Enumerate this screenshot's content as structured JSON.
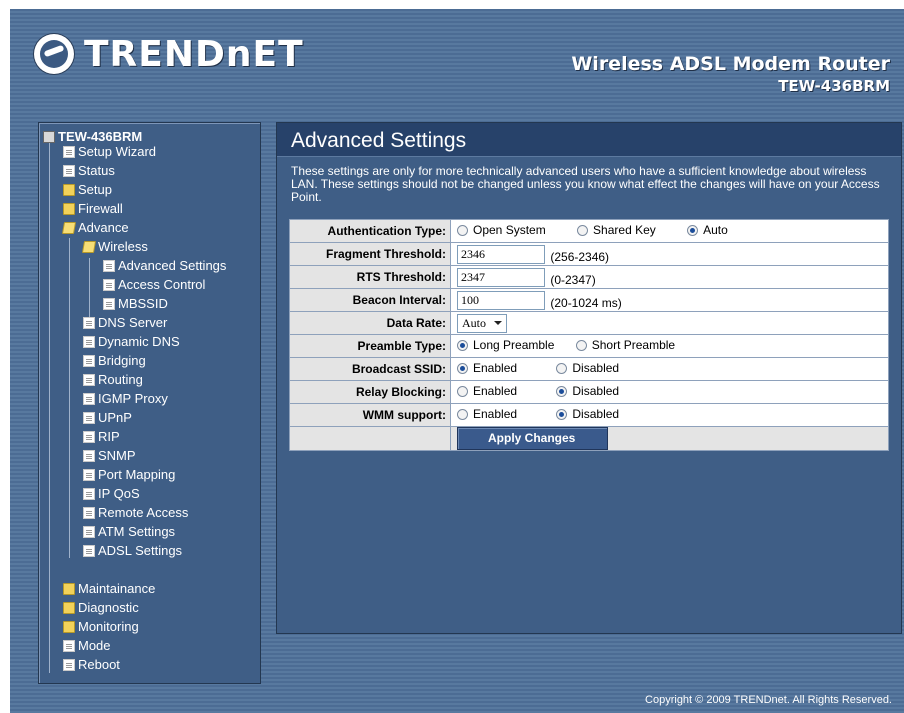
{
  "header": {
    "brand": "TRENDnET",
    "product_title": "Wireless ADSL Modem Router",
    "model": "TEW-436BRM"
  },
  "sidebar": {
    "root": "TEW-436BRM",
    "items": {
      "setup_wizard": "Setup Wizard",
      "status": "Status",
      "setup": "Setup",
      "firewall": "Firewall",
      "advance": "Advance",
      "wireless": "Wireless",
      "advanced_settings": "Advanced Settings",
      "access_control": "Access Control",
      "mbssid": "MBSSID",
      "dns_server": "DNS Server",
      "dynamic_dns": "Dynamic DNS",
      "bridging": "Bridging",
      "routing": "Routing",
      "igmp_proxy": "IGMP Proxy",
      "upnp": "UPnP",
      "rip": "RIP",
      "snmp": "SNMP",
      "port_mapping": "Port Mapping",
      "ip_qos": "IP QoS",
      "remote_access": "Remote Access",
      "atm_settings": "ATM Settings",
      "adsl_settings": "ADSL Settings",
      "maintainance": "Maintainance",
      "diagnostic": "Diagnostic",
      "monitoring": "Monitoring",
      "mode": "Mode",
      "reboot": "Reboot"
    }
  },
  "main": {
    "title": "Advanced Settings",
    "description": "These settings are only for more technically advanced users who have a sufficient knowledge about wireless LAN. These settings should not be changed unless you know what effect the changes will have on your Access Point.",
    "authentication": {
      "label": "Authentication Type:",
      "options": [
        "Open System",
        "Shared Key",
        "Auto"
      ],
      "selected": "Auto"
    },
    "fragment": {
      "label": "Fragment Threshold:",
      "value": "2346",
      "hint": "(256-2346)"
    },
    "rts": {
      "label": "RTS Threshold:",
      "value": "2347",
      "hint": "(0-2347)"
    },
    "beacon": {
      "label": "Beacon Interval:",
      "value": "100",
      "hint": "(20-1024 ms)"
    },
    "data_rate": {
      "label": "Data Rate:",
      "value": "Auto"
    },
    "preamble": {
      "label": "Preamble Type:",
      "options": [
        "Long Preamble",
        "Short Preamble"
      ],
      "selected": "Long Preamble"
    },
    "broadcast_ssid": {
      "label": "Broadcast SSID:",
      "options": [
        "Enabled",
        "Disabled"
      ],
      "selected": "Enabled"
    },
    "relay_blocking": {
      "label": "Relay Blocking:",
      "options": [
        "Enabled",
        "Disabled"
      ],
      "selected": "Disabled"
    },
    "wmm": {
      "label": "WMM support:",
      "options": [
        "Enabled",
        "Disabled"
      ],
      "selected": "Disabled"
    },
    "apply_label": "Apply Changes"
  },
  "footer": {
    "copyright": "Copyright © 2009 TRENDnet. All Rights Reserved."
  }
}
